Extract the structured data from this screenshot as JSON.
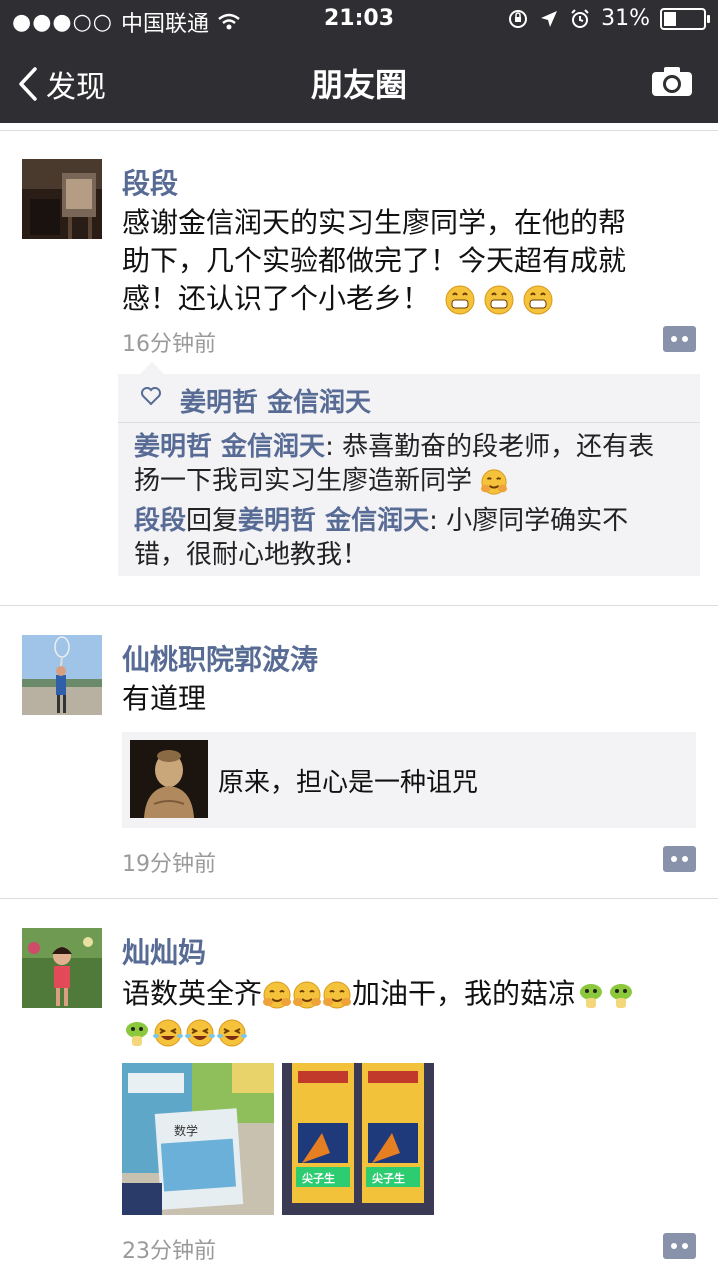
{
  "status_bar": {
    "signal": "●●●○○",
    "carrier": "中国联通",
    "time": "21:03",
    "battery_percent": "31%",
    "battery_level": 0.31
  },
  "nav": {
    "back_label": "发现",
    "title": "朋友圈"
  },
  "posts": [
    {
      "name": "段段",
      "text_lines": [
        "感谢金信润天的实习生廖同学，在他的帮",
        "助下，几个实验都做完了！今天超有成就",
        "感！还认识了个小老乡！"
      ],
      "time": "16分钟前",
      "likes": "姜明哲 金信润天",
      "comments": [
        {
          "user": "姜明哲 金信润天",
          "sep": ": ",
          "line1": "恭喜勤奋的段老师，还有表",
          "line2": "扬一下我司实习生廖造新同学"
        },
        {
          "user": "段段",
          "reply_word": "回复",
          "reply_to": "姜明哲 金信润天",
          "sep": ": ",
          "line1": "小廖同学确实不",
          "line2": "错，很耐心地教我！"
        }
      ]
    },
    {
      "name": "仙桃职院郭波涛",
      "text": "有道理",
      "link_title": "原来，担心是一种诅咒",
      "time": "19分钟前"
    },
    {
      "name": "灿灿妈",
      "text_line1": "语数英全齐",
      "text_mid": "加油干，我的菇凉",
      "time": "23分钟前"
    }
  ],
  "colors": {
    "bar": "#2e2e33",
    "name_link": "#576b95",
    "time_gray": "#9a9a9a",
    "comment_bg": "#f3f3f5"
  }
}
